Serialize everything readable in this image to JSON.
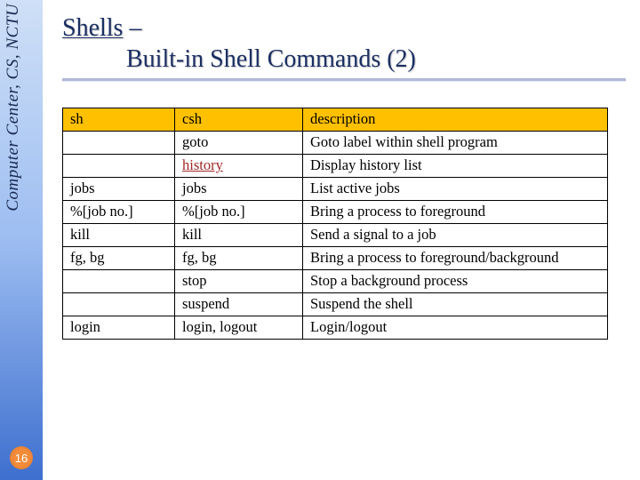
{
  "sidebar": {
    "label": "Computer Center, CS, NCTU"
  },
  "page_number": "16",
  "title": {
    "line1_a": "Shells",
    "line1_b": " – ",
    "line2": "Built-in Shell Commands (2)"
  },
  "table": {
    "headers": {
      "c1": "sh",
      "c2": "csh",
      "c3": "description"
    },
    "rows": [
      {
        "c1": "",
        "c2": "goto",
        "c3": "Goto label within shell program"
      },
      {
        "c1": "",
        "c2": "history",
        "c3": "Display history list",
        "c2_link": true
      },
      {
        "c1": "jobs",
        "c2": "jobs",
        "c3": "List active jobs"
      },
      {
        "c1": "%[job no.]",
        "c2": "%[job no.]",
        "c3": "Bring a process to foreground"
      },
      {
        "c1": "kill",
        "c2": "kill",
        "c3": "Send a signal to a job"
      },
      {
        "c1": "fg, bg",
        "c2": "fg, bg",
        "c3": "Bring a process to foreground/background"
      },
      {
        "c1": "",
        "c2": "stop",
        "c3": "Stop a background process"
      },
      {
        "c1": "",
        "c2": "suspend",
        "c3": "Suspend the shell"
      },
      {
        "c1": "login",
        "c2": "login, logout",
        "c3": "Login/logout"
      }
    ]
  }
}
